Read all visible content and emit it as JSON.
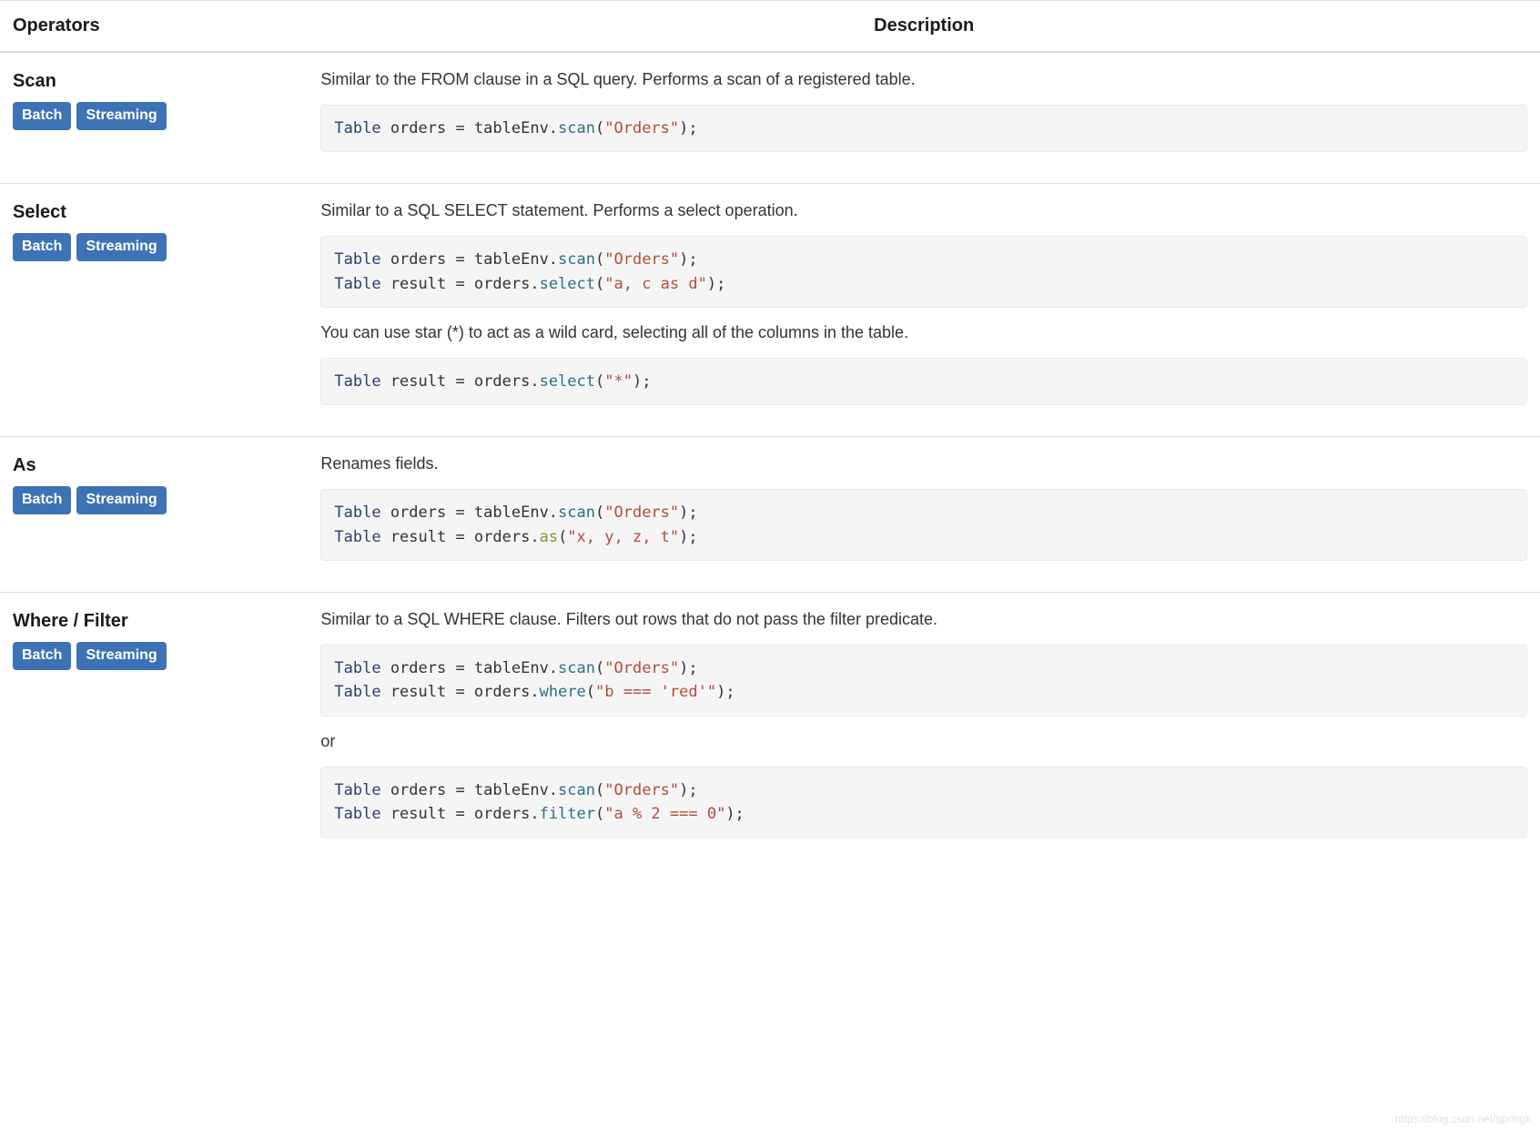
{
  "headers": {
    "operators": "Operators",
    "description": "Description"
  },
  "badges": {
    "batch": "Batch",
    "streaming": "Streaming"
  },
  "rows": [
    {
      "name": "Scan",
      "desc": "Similar to the FROM clause in a SQL query. Performs a scan of a registered table.",
      "blocks": [
        {
          "type": "code",
          "tokens": [
            {
              "c": "k",
              "t": "Table"
            },
            {
              "t": " orders = tableEnv."
            },
            {
              "c": "m",
              "t": "scan"
            },
            {
              "t": "("
            },
            {
              "c": "s",
              "t": "\"Orders\""
            },
            {
              "t": ");"
            }
          ]
        }
      ]
    },
    {
      "name": "Select",
      "desc": "Similar to a SQL SELECT statement. Performs a select operation.",
      "blocks": [
        {
          "type": "code",
          "tokens": [
            {
              "c": "k",
              "t": "Table"
            },
            {
              "t": " orders = tableEnv."
            },
            {
              "c": "m",
              "t": "scan"
            },
            {
              "t": "("
            },
            {
              "c": "s",
              "t": "\"Orders\""
            },
            {
              "t": ");"
            },
            {
              "t": "\n"
            },
            {
              "c": "k",
              "t": "Table"
            },
            {
              "t": " result = orders."
            },
            {
              "c": "m",
              "t": "select"
            },
            {
              "t": "("
            },
            {
              "c": "s",
              "t": "\"a, c as d\""
            },
            {
              "t": ");"
            }
          ]
        },
        {
          "type": "text",
          "text": "You can use star (*) to act as a wild card, selecting all of the columns in the table."
        },
        {
          "type": "code",
          "tokens": [
            {
              "c": "k",
              "t": "Table"
            },
            {
              "t": " result = orders."
            },
            {
              "c": "m",
              "t": "select"
            },
            {
              "t": "("
            },
            {
              "c": "s",
              "t": "\"*\""
            },
            {
              "t": ");"
            }
          ]
        }
      ]
    },
    {
      "name": "As",
      "desc": "Renames fields.",
      "blocks": [
        {
          "type": "code",
          "tokens": [
            {
              "c": "k",
              "t": "Table"
            },
            {
              "t": " orders = tableEnv."
            },
            {
              "c": "m",
              "t": "scan"
            },
            {
              "t": "("
            },
            {
              "c": "s",
              "t": "\"Orders\""
            },
            {
              "t": ");"
            },
            {
              "t": "\n"
            },
            {
              "c": "k",
              "t": "Table"
            },
            {
              "t": " result = orders."
            },
            {
              "c": "a",
              "t": "as"
            },
            {
              "t": "("
            },
            {
              "c": "s",
              "t": "\"x, y, z, t\""
            },
            {
              "t": ");"
            }
          ]
        }
      ]
    },
    {
      "name": "Where / Filter",
      "desc": "Similar to a SQL WHERE clause. Filters out rows that do not pass the filter predicate.",
      "blocks": [
        {
          "type": "code",
          "tokens": [
            {
              "c": "k",
              "t": "Table"
            },
            {
              "t": " orders = tableEnv."
            },
            {
              "c": "m",
              "t": "scan"
            },
            {
              "t": "("
            },
            {
              "c": "s",
              "t": "\"Orders\""
            },
            {
              "t": ");"
            },
            {
              "t": "\n"
            },
            {
              "c": "k",
              "t": "Table"
            },
            {
              "t": " result = orders."
            },
            {
              "c": "m",
              "t": "where"
            },
            {
              "t": "("
            },
            {
              "c": "s",
              "t": "\"b === 'red'\""
            },
            {
              "t": ");"
            }
          ]
        },
        {
          "type": "text",
          "text": "or"
        },
        {
          "type": "code",
          "tokens": [
            {
              "c": "k",
              "t": "Table"
            },
            {
              "t": " orders = tableEnv."
            },
            {
              "c": "m",
              "t": "scan"
            },
            {
              "t": "("
            },
            {
              "c": "s",
              "t": "\"Orders\""
            },
            {
              "t": ");"
            },
            {
              "t": "\n"
            },
            {
              "c": "k",
              "t": "Table"
            },
            {
              "t": " result = orders."
            },
            {
              "c": "m",
              "t": "filter"
            },
            {
              "t": "("
            },
            {
              "c": "s",
              "t": "\"a % 2 === 0\""
            },
            {
              "t": ");"
            }
          ]
        }
      ]
    }
  ],
  "watermark": "https://blog.csdn.net/springk"
}
